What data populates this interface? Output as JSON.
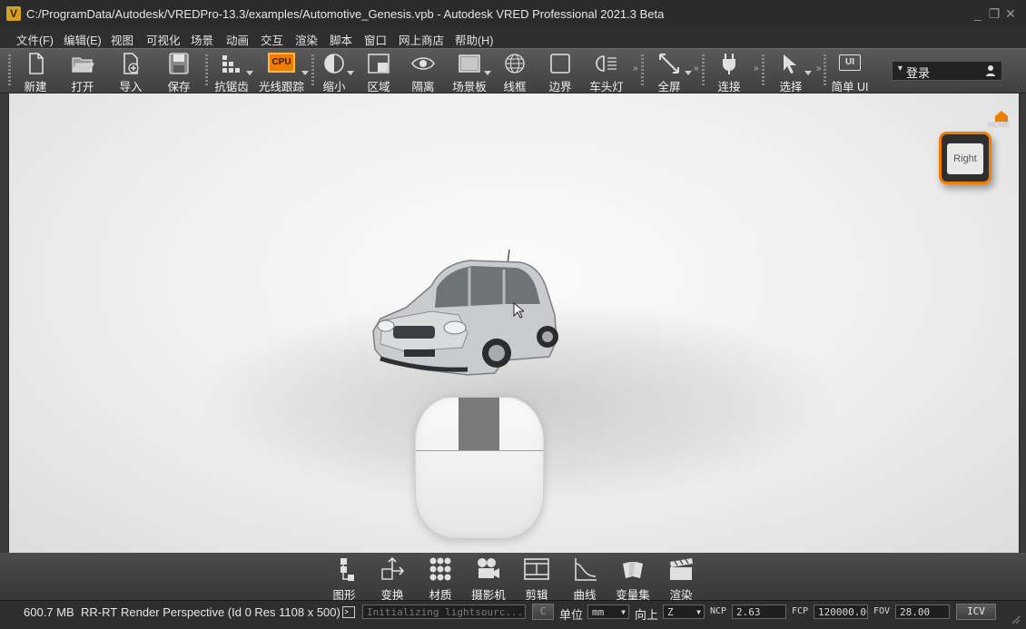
{
  "window": {
    "title": "C:/ProgramData/Autodesk/VREDPro-13.3/examples/Automotive_Genesis.vpb - Autodesk VRED Professional 2021.3 Beta",
    "logo_letter": "V",
    "minimize": "_",
    "restore": "❐",
    "close": "✕"
  },
  "menu": [
    "文件(F)",
    "编辑(E)",
    "视图",
    "可视化",
    "场景",
    "动画",
    "交互",
    "渲染",
    "脚本",
    "窗口",
    "网上商店",
    "帮助(H)"
  ],
  "toolbar": {
    "new": "新建",
    "open": "打开",
    "import": "导入",
    "save": "保存",
    "antialias": "抗锯齿",
    "raytracing": "光线跟踪",
    "raytracing_badge": "CPU",
    "zoom": "缩小",
    "region": "区域",
    "isolate": "隔离",
    "sceneplate": "场景板",
    "wireframe": "线框",
    "boundary": "边界",
    "headlight": "车头灯",
    "fullscreen": "全屏",
    "connect": "连接",
    "select": "选择",
    "simple_ui": "简单 UI",
    "simple_ui_icon": "UI",
    "login": "登录"
  },
  "viewport": {
    "home_label": "HOME",
    "cube_face": "Right"
  },
  "bottom_toolbar": [
    "图形",
    "变换",
    "材质",
    "摄影机",
    "剪辑",
    "曲线",
    "变量集",
    "渲染"
  ],
  "status": {
    "memory": "600.7 MB",
    "mode": "RR-RT",
    "render_info": "Render Perspective (Id 0 Res 1108 x 500)",
    "progress_text": "Initializing lightsourc...",
    "c_button": "C",
    "unit_label": "单位",
    "unit_value": "mm",
    "up_label": "向上",
    "up_value": "Z",
    "ncp_label": "NCP",
    "ncp_value": "2.63",
    "fcp_label": "FCP",
    "fcp_value": "120000.00",
    "fov_label": "FOV",
    "fov_value": "28.00",
    "icv_button": "ICV"
  },
  "colors": {
    "accent": "#f07d00",
    "background": "#3a3a3a",
    "viewport": "#eeeeee"
  }
}
